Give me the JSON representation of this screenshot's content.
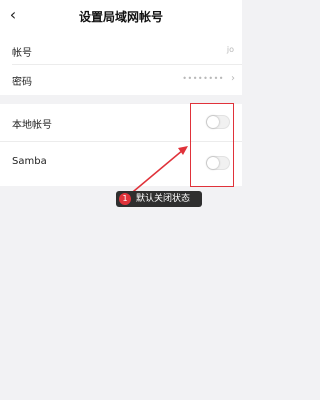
{
  "header": {
    "back_icon": "chevron-left-icon",
    "back_glyph": "‹",
    "title": "设置局域网帐号"
  },
  "account_section": {
    "rows": [
      {
        "label": "帐号",
        "value": "jo"
      },
      {
        "label": "密码",
        "value": "••••••••",
        "chevron": "›"
      }
    ]
  },
  "toggle_section": {
    "rows": [
      {
        "label": "本地帐号",
        "enabled": false
      },
      {
        "label": "Samba",
        "enabled": false
      }
    ]
  },
  "annotation": {
    "number": "1",
    "text": "默认关闭状态",
    "highlight_color": "#e0323a"
  }
}
